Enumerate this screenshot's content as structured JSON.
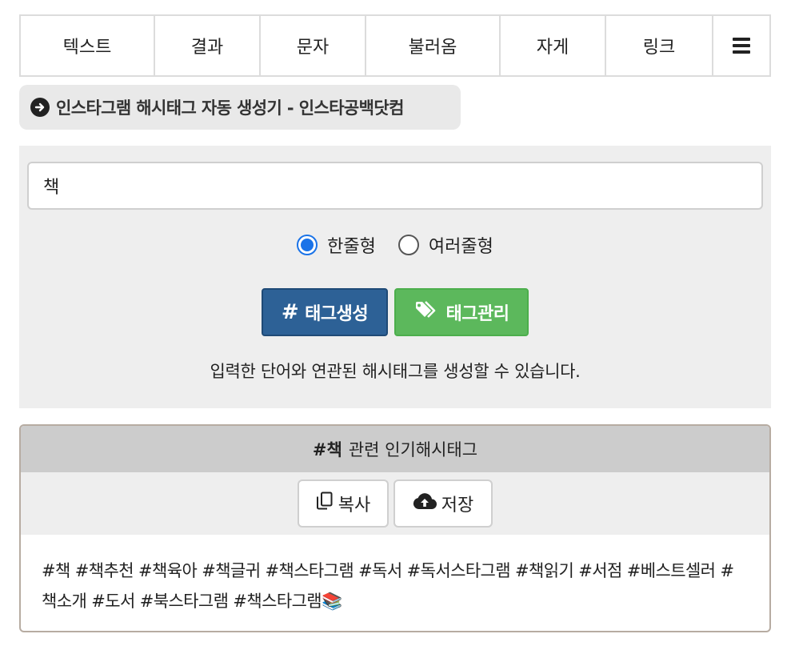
{
  "nav": {
    "items": [
      {
        "label": "텍스트"
      },
      {
        "label": "결과"
      },
      {
        "label": "문자"
      },
      {
        "label": "불러옴"
      },
      {
        "label": "자게"
      },
      {
        "label": "링크"
      }
    ],
    "menu_icon": "hamburger-menu-icon"
  },
  "page": {
    "title": "인스타그램 해시태그 자동 생성기 - 인스타공백닷컴",
    "title_icon": "arrow-right-circle-icon"
  },
  "generator": {
    "keyword_value": "책",
    "options": [
      {
        "label": "한줄형",
        "checked": true
      },
      {
        "label": "여러줄형",
        "checked": false
      }
    ],
    "generate_label": "태그생성",
    "generate_icon": "hash-icon",
    "manage_label": "태그관리",
    "manage_icon": "tags-icon",
    "helper_text": "입력한 단어와 연관된 해시태그를 생성할 수 있습니다.",
    "colors": {
      "primary": "#2d6196",
      "success": "#5cb85c",
      "radio": "#1a73e8"
    }
  },
  "result": {
    "keyword_tag": "#책",
    "heading_suffix": "관련 인기해시태그",
    "copy_label": "복사",
    "copy_icon": "copy-icon",
    "save_label": "저장",
    "save_icon": "cloud-upload-icon",
    "tags_text": "#책 #책추천 #책육아 #책글귀 #책스타그램 #독서 #독서스타그램 #책읽기 #서점 #베스트셀러 #책소개 #도서 #북스타그램 #책스타그램📚"
  }
}
